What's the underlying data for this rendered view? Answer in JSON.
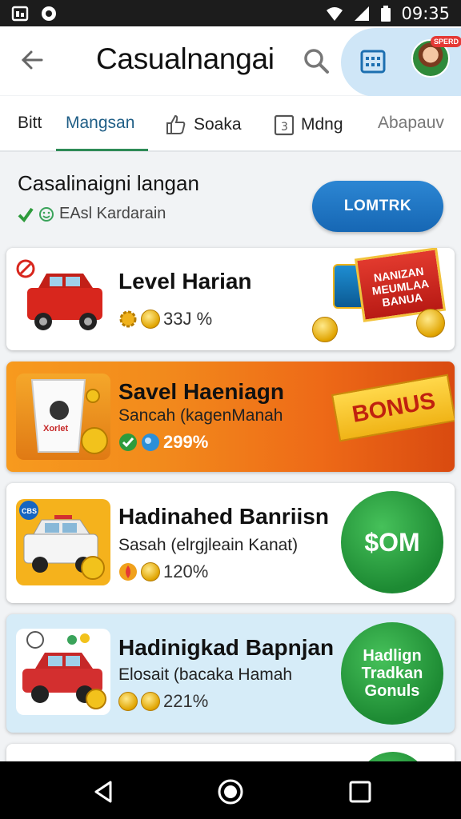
{
  "status_bar": {
    "time": "09:35"
  },
  "app_bar": {
    "title": "Casualnangai",
    "avatar_badge": "SPERD"
  },
  "tabs": [
    {
      "label": "Bitt"
    },
    {
      "label": "Mangsan"
    },
    {
      "label": "Soaka"
    },
    {
      "label": "Mdng"
    },
    {
      "label": "Abapauv"
    }
  ],
  "section": {
    "title": "Casalinaigni langan",
    "subtitle": "EAsl Kardarain",
    "button_label": "LOMTRK"
  },
  "cards": [
    {
      "title": "Level Harian",
      "subtitle": "",
      "meta": "33J %",
      "badge_text": "NANIZAN MEUMLAA BANUA"
    },
    {
      "title": "Savel Haeniagn",
      "subtitle": "Sancah (kagenManah",
      "meta": "299%",
      "badge_text": "BONUS",
      "thumb_text": "Xorlet"
    },
    {
      "title": "Hadinahed Banriisn",
      "subtitle": "Sasah (elrgjleain Kanat)",
      "meta": "120%",
      "badge_text": "$OM",
      "thumb_badge": "CBS"
    },
    {
      "title": "Hadinigkad Bapnjan",
      "subtitle": "Elosait (bacaka Hamah",
      "meta": "221%",
      "badge_text": "Hadlign Tradkan Gonuls"
    }
  ],
  "colors": {
    "accent_blue": "#1f5e86",
    "tab_underline": "#2e8b57",
    "primary_button": "#1b74c4",
    "bonus_orange": "#f28a1c"
  }
}
